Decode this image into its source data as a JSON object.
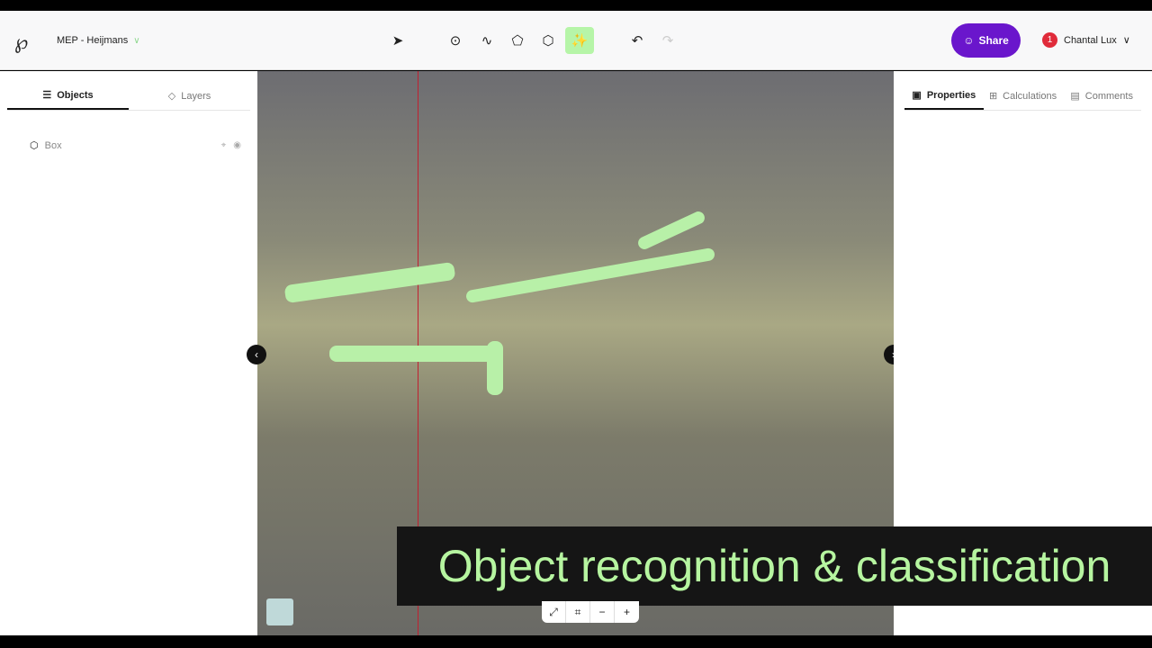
{
  "header": {
    "project": "MEP - Heijmans",
    "share_label": "Share",
    "user_name": "Chantal Lux",
    "notification_count": "1"
  },
  "left_panel": {
    "tabs": [
      {
        "label": "Objects"
      },
      {
        "label": "Layers"
      }
    ],
    "objects": [
      {
        "label": "Box"
      }
    ]
  },
  "right_panel": {
    "tabs": [
      {
        "label": "Properties"
      },
      {
        "label": "Calculations"
      },
      {
        "label": "Comments"
      }
    ]
  },
  "caption": "Object recognition & classification",
  "colors": {
    "accent": "#6a16cc",
    "active_tool": "#b6f5a8",
    "caption_text": "#b6f5a0"
  }
}
